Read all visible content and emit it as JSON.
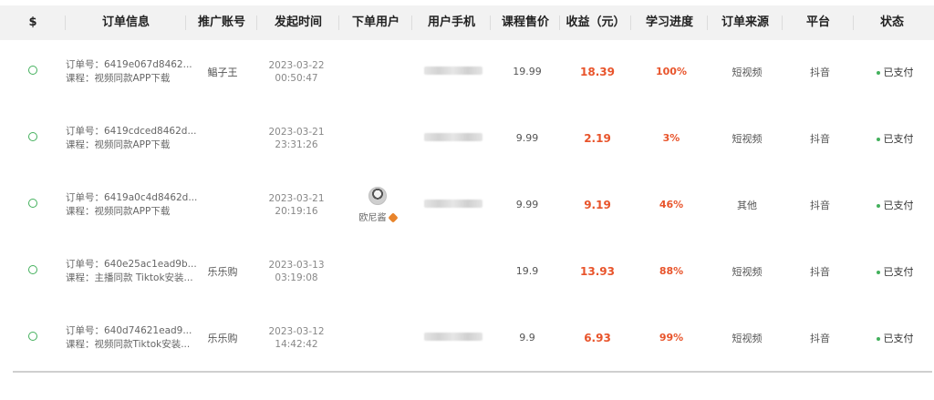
{
  "columns": {
    "select": "$",
    "order_info": "订单信息",
    "promoter": "推广账号",
    "created": "发起时间",
    "buyer": "下单用户",
    "phone": "用户手机",
    "price": "课程售价",
    "profit": "收益（元）",
    "progress": "学习进度",
    "source": "订单来源",
    "platform": "平台",
    "status": "状态"
  },
  "rows": [
    {
      "order_no": "订单号：6419e067d8462...",
      "course": "课程：视频同款APP下载",
      "promoter": "鲳子王",
      "date": "2023-03-22",
      "time": "00:50:47",
      "buyer": "",
      "price": "19.99",
      "profit": "18.39",
      "progress": "100%",
      "source": "短视频",
      "platform": "抖音",
      "status": "已支付"
    },
    {
      "order_no": "订单号：6419cdced8462d...",
      "course": "课程：视频同款APP下载",
      "promoter": "",
      "date": "2023-03-21",
      "time": "23:31:26",
      "buyer": "",
      "price": "9.99",
      "profit": "2.19",
      "progress": "3%",
      "source": "短视频",
      "platform": "抖音",
      "status": "已支付"
    },
    {
      "order_no": "订单号：6419a0c4d8462d...",
      "course": "课程：视频同款APP下载",
      "promoter": "",
      "date": "2023-03-21",
      "time": "20:19:16",
      "buyer": "欧尼酱",
      "price": "9.99",
      "profit": "9.19",
      "progress": "46%",
      "source": "其他",
      "platform": "抖音",
      "status": "已支付"
    },
    {
      "order_no": "订单号：640e25ac1ead9b...",
      "course": "课程：主播同款 Tiktok安装...",
      "promoter": "乐乐购",
      "date": "2023-03-13",
      "time": "03:19:08",
      "buyer": "",
      "price": "19.9",
      "profit": "13.93",
      "progress": "88%",
      "source": "短视频",
      "platform": "抖音",
      "status": "已支付"
    },
    {
      "order_no": "订单号：640d74621ead9...",
      "course": "课程：视频同款Tiktok安装...",
      "promoter": "乐乐购",
      "date": "2023-03-12",
      "time": "14:42:42",
      "buyer": "",
      "price": "9.9",
      "profit": "6.93",
      "progress": "99%",
      "source": "短视频",
      "platform": "抖音",
      "status": "已支付"
    }
  ],
  "colors": {
    "accent_profit": "#e8542b",
    "status_dot": "#43b05c",
    "header_bg": "#f2f2f2"
  }
}
